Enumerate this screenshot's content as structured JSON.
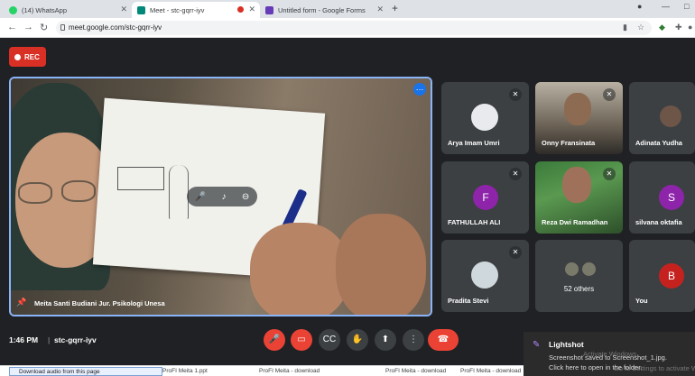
{
  "browser": {
    "tabs": [
      {
        "label": "(14) WhatsApp",
        "active": false,
        "favicon_color": "#25d366"
      },
      {
        "label": "Meet - stc-gqrr-iyv",
        "active": true,
        "favicon_color": "#00897b"
      },
      {
        "label": "Untitled form - Google Forms",
        "active": false,
        "favicon_color": "#673ab7"
      }
    ],
    "url": "meet.google.com/stc-gqrr-iyv"
  },
  "meet": {
    "rec_label": "REC",
    "main_speaker": "Meita Santi Budiani Jur. Psikologi Unesa",
    "participants": [
      {
        "name": "Arya Imam Umri",
        "kind": "image"
      },
      {
        "name": "Onny Fransinata",
        "kind": "photo"
      },
      {
        "name": "Adinata Yudha",
        "kind": "photo"
      },
      {
        "name": "FATHULLAH ALI",
        "kind": "letter",
        "letter": "F",
        "color": "#8e24aa"
      },
      {
        "name": "Reza Dwi Ramadhan",
        "kind": "photo"
      },
      {
        "name": "silvana oktafia",
        "kind": "letter",
        "letter": "S",
        "color": "#8e24aa"
      },
      {
        "name": "Pradita Stevi",
        "kind": "image"
      },
      {
        "name": "52 others",
        "kind": "others"
      },
      {
        "name": "You",
        "kind": "letter",
        "letter": "B",
        "color": "#c5221f"
      }
    ],
    "time": "1:46 PM",
    "separator": "|",
    "meeting_code": "stc-gqrr-iyv"
  },
  "toast": {
    "title": "Lightshot",
    "line1": "Screenshot saved to Screenshot_1.jpg.",
    "line2": "Click here to open in the folder.",
    "watermark1": "Activate Windows",
    "watermark2": "Go to Settings to activate Windows."
  },
  "downloads": {
    "active": "Download audio from this page",
    "items": [
      "ProFI Meita 1.ppt",
      "ProFI Meita - download",
      "ProFI Meita - download",
      "ProFI Meita - download"
    ]
  },
  "colors": {
    "accent": "#8ab4f8",
    "danger": "#ea4335",
    "surface": "#3c4043",
    "bg": "#202124"
  }
}
